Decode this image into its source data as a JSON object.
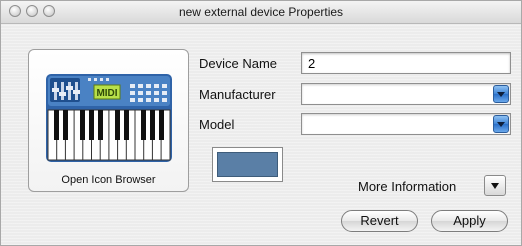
{
  "window": {
    "title": "new external device Properties"
  },
  "icon_panel": {
    "caption": "Open Icon Browser",
    "icon": "midi-keyboard-icon",
    "icon_text": "MIDI"
  },
  "form": {
    "device_name": {
      "label": "Device Name",
      "value": "2"
    },
    "manufacturer": {
      "label": "Manufacturer",
      "value": ""
    },
    "model": {
      "label": "Model",
      "value": ""
    }
  },
  "color_swatch": {
    "color": "#5a7fa6"
  },
  "more_information": {
    "label": "More Information"
  },
  "buttons": {
    "revert": "Revert",
    "apply": "Apply"
  },
  "colors": {
    "accent_arrow": "#3f84d6",
    "window_bg": "#ececec"
  }
}
